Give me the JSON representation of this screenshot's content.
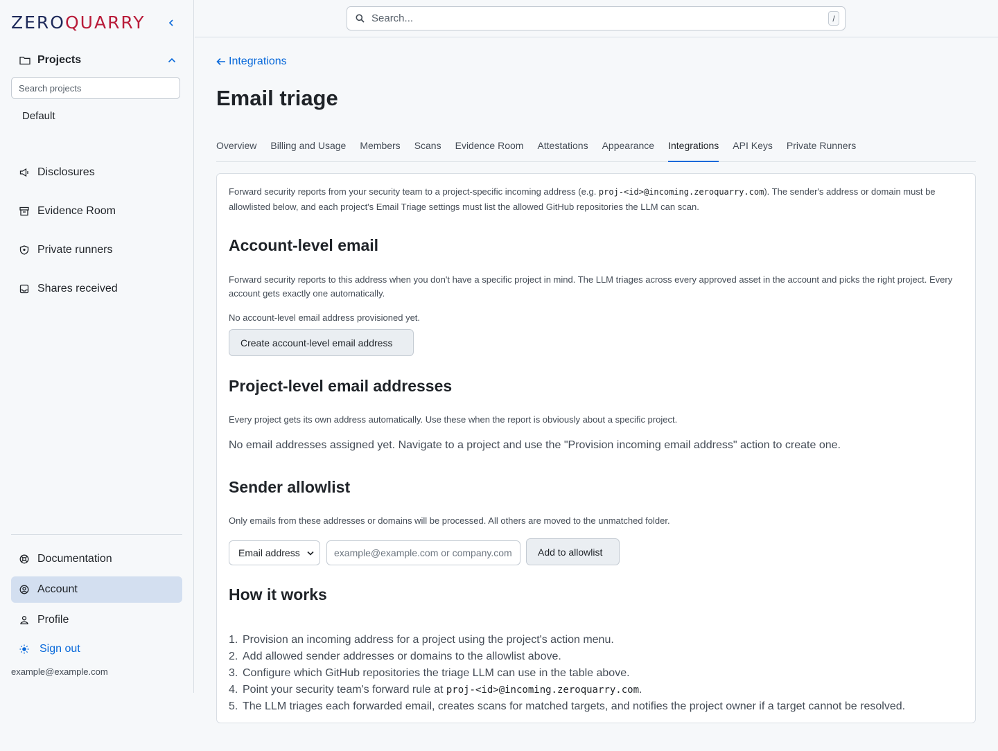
{
  "brand": {
    "logo_zero": "ZERO",
    "logo_quarry": "QUARRY"
  },
  "sidebar": {
    "projects_label": "Projects",
    "search_placeholder": "Search projects",
    "project_default": "Default",
    "nav": [
      {
        "label": "Disclosures",
        "icon": "megaphone-icon"
      },
      {
        "label": "Evidence Room",
        "icon": "archive-icon"
      },
      {
        "label": "Private runners",
        "icon": "shield-icon"
      },
      {
        "label": "Shares received",
        "icon": "inbox-icon"
      }
    ],
    "bottom": [
      {
        "label": "Documentation",
        "icon": "lifebuoy-icon"
      },
      {
        "label": "Account",
        "icon": "user-circle-icon",
        "active": true
      },
      {
        "label": "Profile",
        "icon": "person-icon"
      }
    ],
    "sign_out": "Sign out",
    "user_email": "example@example.com"
  },
  "header": {
    "search_placeholder": "Search...",
    "shortcut": "/"
  },
  "breadcrumb": {
    "back_label": "Integrations"
  },
  "page": {
    "title": "Email triage"
  },
  "tabs": [
    "Overview",
    "Billing and Usage",
    "Members",
    "Scans",
    "Evidence Room",
    "Attestations",
    "Appearance",
    "Integrations",
    "API Keys",
    "Private Runners"
  ],
  "active_tab": "Integrations",
  "intro": {
    "part1": "Forward security reports from your security team to a project-specific incoming address (e.g. ",
    "code": "proj-<id>@incoming.zeroquarry.com",
    "part2": "). The sender's address or domain must be allowlisted below, and each project's Email Triage settings must list the allowed GitHub repositories the LLM can scan."
  },
  "account_email": {
    "heading": "Account-level email",
    "description": "Forward security reports to this address when you don't have a specific project in mind. The LLM triages across every approved asset in the account and picks the right project. Every account gets exactly one automatically.",
    "status": "No account-level email address provisioned yet.",
    "button": "Create account-level email address"
  },
  "project_emails": {
    "heading": "Project-level email addresses",
    "description": "Every project gets its own address automatically. Use these when the report is obviously about a specific project.",
    "empty": "No email addresses assigned yet. Navigate to a project and use the \"Provision incoming email address\" action to create one."
  },
  "allowlist": {
    "heading": "Sender allowlist",
    "description": "Only emails from these addresses or domains will be processed. All others are moved to the unmatched folder.",
    "type_selected": "Email address",
    "input_placeholder": "example@example.com or company.com",
    "button": "Add to allowlist"
  },
  "how_it_works": {
    "heading": "How it works",
    "steps": [
      "Provision an incoming address for a project using the project's action menu.",
      "Add allowed sender addresses or domains to the allowlist above.",
      "Configure which GitHub repositories the triage LLM can use in the table above.",
      "Point your security team's forward rule at ",
      "The LLM triages each forwarded email, creates scans for matched targets, and notifies the project owner if a target cannot be resolved."
    ],
    "step4_code": "proj-<id>@incoming.zeroquarry.com",
    "step4_suffix": "."
  },
  "colors": {
    "accent": "#0969da",
    "brand_navy": "#1e2a5a",
    "brand_red": "#b91c3a",
    "active_nav": "#d3dff0"
  }
}
